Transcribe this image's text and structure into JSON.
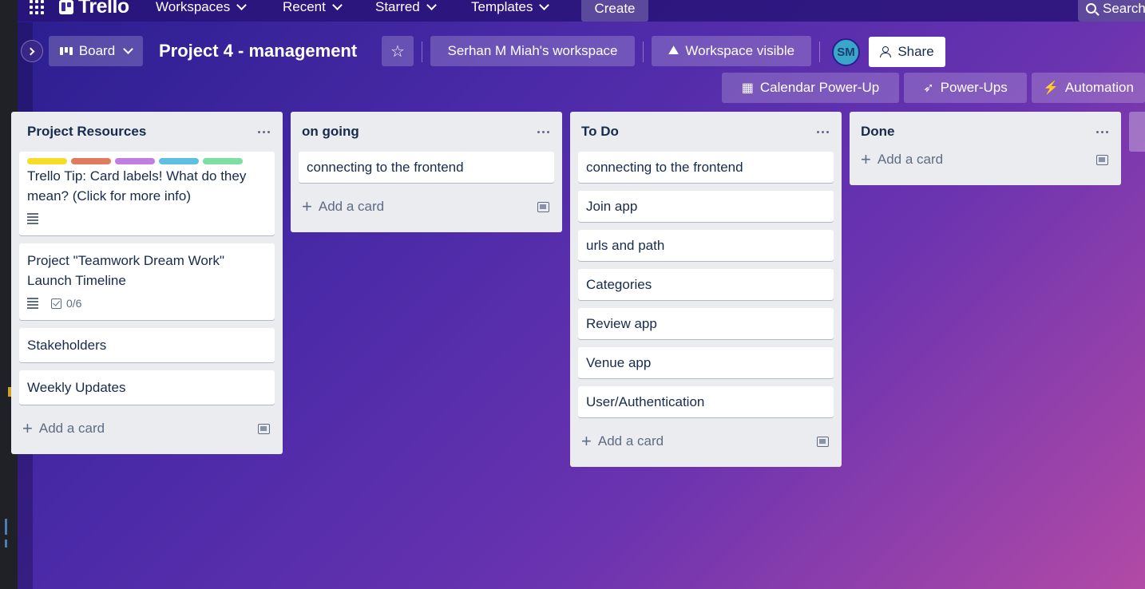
{
  "topnav": {
    "logo": "Trello",
    "items": [
      {
        "label": "Workspaces"
      },
      {
        "label": "Recent"
      },
      {
        "label": "Starred"
      },
      {
        "label": "Templates"
      }
    ],
    "create_label": "Create",
    "search_placeholder": "Search"
  },
  "header": {
    "view_label": "Board",
    "board_title": "Project 4 - management",
    "workspace_label": "Serhan M Miah's workspace",
    "visibility_label": "Workspace visible",
    "avatar_initials": "SM",
    "share_label": "Share",
    "calendar_label": "Calendar Power-Up",
    "powerups_label": "Power-Ups",
    "automation_label": "Automation"
  },
  "lists": [
    {
      "title": "Project Resources",
      "cards": [
        {
          "title": "Trello Tip: Card labels! What do they mean? (Click for more info)",
          "labels": [
            "#f5dd29",
            "#e07b5f",
            "#c07ee0",
            "#5ec0e0",
            "#7de0a0"
          ],
          "has_description": true
        },
        {
          "title": "Project \"Teamwork Dream Work\" Launch Timeline",
          "has_description": true,
          "checklist": "0/6"
        },
        {
          "title": "Stakeholders"
        },
        {
          "title": "Weekly Updates"
        }
      ],
      "add_label": "Add a card"
    },
    {
      "title": "on going",
      "cards": [
        {
          "title": "connecting to the frontend"
        }
      ],
      "add_label": "Add a card"
    },
    {
      "title": "To Do",
      "cards": [
        {
          "title": "connecting to the frontend"
        },
        {
          "title": "Join app"
        },
        {
          "title": "urls and path"
        },
        {
          "title": "Categories"
        },
        {
          "title": "Review app"
        },
        {
          "title": "Venue app"
        },
        {
          "title": "User/Authentication"
        }
      ],
      "add_label": "Add a card"
    },
    {
      "title": "Done",
      "cards": [],
      "add_label": "Add a card"
    }
  ]
}
